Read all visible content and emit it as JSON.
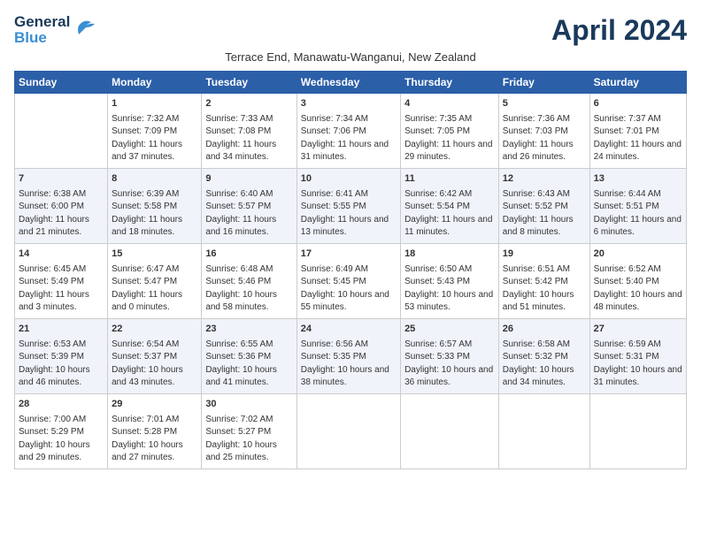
{
  "logo": {
    "line1": "General",
    "line2": "Blue"
  },
  "title": "April 2024",
  "location": "Terrace End, Manawatu-Wanganui, New Zealand",
  "days_of_week": [
    "Sunday",
    "Monday",
    "Tuesday",
    "Wednesday",
    "Thursday",
    "Friday",
    "Saturday"
  ],
  "weeks": [
    [
      {
        "day": "",
        "sunrise": "",
        "sunset": "",
        "daylight": ""
      },
      {
        "day": "1",
        "sunrise": "Sunrise: 7:32 AM",
        "sunset": "Sunset: 7:09 PM",
        "daylight": "Daylight: 11 hours and 37 minutes."
      },
      {
        "day": "2",
        "sunrise": "Sunrise: 7:33 AM",
        "sunset": "Sunset: 7:08 PM",
        "daylight": "Daylight: 11 hours and 34 minutes."
      },
      {
        "day": "3",
        "sunrise": "Sunrise: 7:34 AM",
        "sunset": "Sunset: 7:06 PM",
        "daylight": "Daylight: 11 hours and 31 minutes."
      },
      {
        "day": "4",
        "sunrise": "Sunrise: 7:35 AM",
        "sunset": "Sunset: 7:05 PM",
        "daylight": "Daylight: 11 hours and 29 minutes."
      },
      {
        "day": "5",
        "sunrise": "Sunrise: 7:36 AM",
        "sunset": "Sunset: 7:03 PM",
        "daylight": "Daylight: 11 hours and 26 minutes."
      },
      {
        "day": "6",
        "sunrise": "Sunrise: 7:37 AM",
        "sunset": "Sunset: 7:01 PM",
        "daylight": "Daylight: 11 hours and 24 minutes."
      }
    ],
    [
      {
        "day": "7",
        "sunrise": "Sunrise: 6:38 AM",
        "sunset": "Sunset: 6:00 PM",
        "daylight": "Daylight: 11 hours and 21 minutes."
      },
      {
        "day": "8",
        "sunrise": "Sunrise: 6:39 AM",
        "sunset": "Sunset: 5:58 PM",
        "daylight": "Daylight: 11 hours and 18 minutes."
      },
      {
        "day": "9",
        "sunrise": "Sunrise: 6:40 AM",
        "sunset": "Sunset: 5:57 PM",
        "daylight": "Daylight: 11 hours and 16 minutes."
      },
      {
        "day": "10",
        "sunrise": "Sunrise: 6:41 AM",
        "sunset": "Sunset: 5:55 PM",
        "daylight": "Daylight: 11 hours and 13 minutes."
      },
      {
        "day": "11",
        "sunrise": "Sunrise: 6:42 AM",
        "sunset": "Sunset: 5:54 PM",
        "daylight": "Daylight: 11 hours and 11 minutes."
      },
      {
        "day": "12",
        "sunrise": "Sunrise: 6:43 AM",
        "sunset": "Sunset: 5:52 PM",
        "daylight": "Daylight: 11 hours and 8 minutes."
      },
      {
        "day": "13",
        "sunrise": "Sunrise: 6:44 AM",
        "sunset": "Sunset: 5:51 PM",
        "daylight": "Daylight: 11 hours and 6 minutes."
      }
    ],
    [
      {
        "day": "14",
        "sunrise": "Sunrise: 6:45 AM",
        "sunset": "Sunset: 5:49 PM",
        "daylight": "Daylight: 11 hours and 3 minutes."
      },
      {
        "day": "15",
        "sunrise": "Sunrise: 6:47 AM",
        "sunset": "Sunset: 5:47 PM",
        "daylight": "Daylight: 11 hours and 0 minutes."
      },
      {
        "day": "16",
        "sunrise": "Sunrise: 6:48 AM",
        "sunset": "Sunset: 5:46 PM",
        "daylight": "Daylight: 10 hours and 58 minutes."
      },
      {
        "day": "17",
        "sunrise": "Sunrise: 6:49 AM",
        "sunset": "Sunset: 5:45 PM",
        "daylight": "Daylight: 10 hours and 55 minutes."
      },
      {
        "day": "18",
        "sunrise": "Sunrise: 6:50 AM",
        "sunset": "Sunset: 5:43 PM",
        "daylight": "Daylight: 10 hours and 53 minutes."
      },
      {
        "day": "19",
        "sunrise": "Sunrise: 6:51 AM",
        "sunset": "Sunset: 5:42 PM",
        "daylight": "Daylight: 10 hours and 51 minutes."
      },
      {
        "day": "20",
        "sunrise": "Sunrise: 6:52 AM",
        "sunset": "Sunset: 5:40 PM",
        "daylight": "Daylight: 10 hours and 48 minutes."
      }
    ],
    [
      {
        "day": "21",
        "sunrise": "Sunrise: 6:53 AM",
        "sunset": "Sunset: 5:39 PM",
        "daylight": "Daylight: 10 hours and 46 minutes."
      },
      {
        "day": "22",
        "sunrise": "Sunrise: 6:54 AM",
        "sunset": "Sunset: 5:37 PM",
        "daylight": "Daylight: 10 hours and 43 minutes."
      },
      {
        "day": "23",
        "sunrise": "Sunrise: 6:55 AM",
        "sunset": "Sunset: 5:36 PM",
        "daylight": "Daylight: 10 hours and 41 minutes."
      },
      {
        "day": "24",
        "sunrise": "Sunrise: 6:56 AM",
        "sunset": "Sunset: 5:35 PM",
        "daylight": "Daylight: 10 hours and 38 minutes."
      },
      {
        "day": "25",
        "sunrise": "Sunrise: 6:57 AM",
        "sunset": "Sunset: 5:33 PM",
        "daylight": "Daylight: 10 hours and 36 minutes."
      },
      {
        "day": "26",
        "sunrise": "Sunrise: 6:58 AM",
        "sunset": "Sunset: 5:32 PM",
        "daylight": "Daylight: 10 hours and 34 minutes."
      },
      {
        "day": "27",
        "sunrise": "Sunrise: 6:59 AM",
        "sunset": "Sunset: 5:31 PM",
        "daylight": "Daylight: 10 hours and 31 minutes."
      }
    ],
    [
      {
        "day": "28",
        "sunrise": "Sunrise: 7:00 AM",
        "sunset": "Sunset: 5:29 PM",
        "daylight": "Daylight: 10 hours and 29 minutes."
      },
      {
        "day": "29",
        "sunrise": "Sunrise: 7:01 AM",
        "sunset": "Sunset: 5:28 PM",
        "daylight": "Daylight: 10 hours and 27 minutes."
      },
      {
        "day": "30",
        "sunrise": "Sunrise: 7:02 AM",
        "sunset": "Sunset: 5:27 PM",
        "daylight": "Daylight: 10 hours and 25 minutes."
      },
      {
        "day": "",
        "sunrise": "",
        "sunset": "",
        "daylight": ""
      },
      {
        "day": "",
        "sunrise": "",
        "sunset": "",
        "daylight": ""
      },
      {
        "day": "",
        "sunrise": "",
        "sunset": "",
        "daylight": ""
      },
      {
        "day": "",
        "sunrise": "",
        "sunset": "",
        "daylight": ""
      }
    ]
  ]
}
